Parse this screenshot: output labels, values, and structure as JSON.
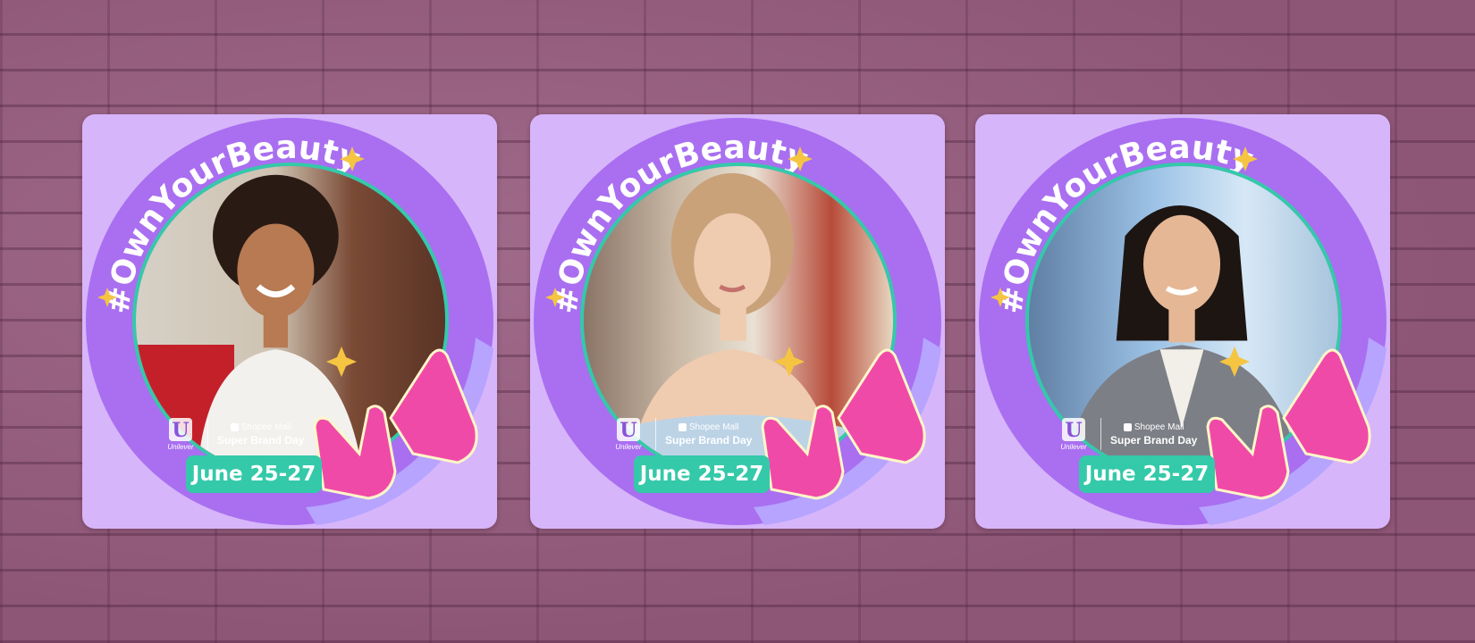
{
  "frames": [
    {
      "hashtag": "#OwnYourBeauty",
      "brand": "Unilever",
      "partner_top": "Shopee Mall",
      "partner_bottom": "Super Brand Day",
      "date": "June 25-27",
      "photo_subject": "woman-curly-hair-white-top"
    },
    {
      "hashtag": "#OwnYourBeauty",
      "brand": "Unilever",
      "partner_top": "Shopee Mall",
      "partner_bottom": "Super Brand Day",
      "date": "June 25-27",
      "photo_subject": "woman-blonde-hair-street"
    },
    {
      "hashtag": "#OwnYourBeauty",
      "brand": "Unilever",
      "partner_top": "Shopee Mall",
      "partner_bottom": "Super Brand Day",
      "date": "June 25-27",
      "photo_subject": "woman-dark-hair-grey-blazer"
    }
  ],
  "colors": {
    "wall": "#935c7c",
    "card": "#d7b5fa",
    "ring": "#a96ff0",
    "accent": "#34c9a9",
    "hand": "#f04aa8",
    "sparkle": "#f5c542"
  },
  "icons": [
    "unilever-logo",
    "shopee-bag-icon",
    "sparkle-icon",
    "hand-icon"
  ]
}
